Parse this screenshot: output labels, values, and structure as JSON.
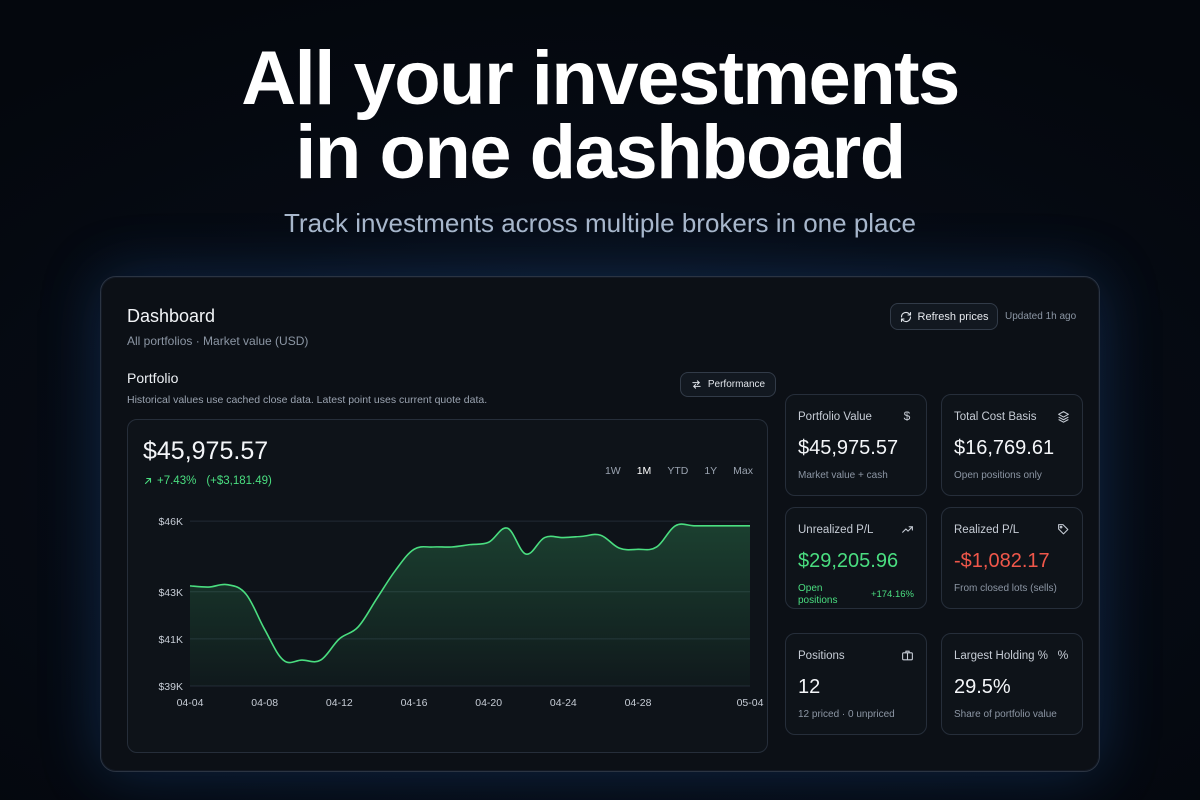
{
  "hero": {
    "title_line1": "All your investments",
    "title_line2": "in one dashboard",
    "subtitle": "Track investments across multiple brokers in one place"
  },
  "dashboard": {
    "title": "Dashboard",
    "subtitle": "All portfolios · Market value (USD)",
    "refresh_label": "Refresh prices",
    "updated": "Updated 1h ago"
  },
  "portfolio": {
    "title": "Portfolio",
    "note": "Historical values use cached close data. Latest point uses current quote data.",
    "performance_label": "Performance",
    "value": "$45,975.57",
    "change_pct": "+7.43%",
    "change_abs": "(+$3,181.49)",
    "ranges": [
      "1W",
      "1M",
      "YTD",
      "1Y",
      "Max"
    ],
    "active_range": "1M"
  },
  "chart_data": {
    "type": "area",
    "x": [
      "04-04",
      "04-05",
      "04-06",
      "04-07",
      "04-08",
      "04-09",
      "04-10",
      "04-11",
      "04-12",
      "04-13",
      "04-14",
      "04-15",
      "04-16",
      "04-17",
      "04-18",
      "04-19",
      "04-20",
      "04-21",
      "04-22",
      "04-23",
      "04-24",
      "04-25",
      "04-26",
      "04-27",
      "04-28",
      "04-29",
      "04-30",
      "05-01",
      "05-02",
      "05-03",
      "05-04"
    ],
    "values": [
      43250,
      43200,
      43300,
      42900,
      41400,
      40100,
      40100,
      40100,
      41000,
      41500,
      42700,
      43900,
      44800,
      44900,
      44900,
      45000,
      45100,
      45700,
      44600,
      45300,
      45300,
      45350,
      45400,
      44850,
      44800,
      44900,
      45800,
      45800,
      45800,
      45800,
      45800
    ],
    "x_tick_labels": [
      "04-04",
      "04-08",
      "04-12",
      "04-16",
      "04-20",
      "04-24",
      "04-28",
      "05-04"
    ],
    "y_tick_labels": [
      "$46K",
      "$43K",
      "$41K",
      "$39K"
    ],
    "y_ticks": [
      46000,
      43000,
      41000,
      39000
    ],
    "ylim": [
      39000,
      46300
    ],
    "grid": true,
    "line_color": "#4ade80"
  },
  "stats": [
    {
      "label": "Portfolio Value",
      "icon": "dollar-icon",
      "glyph": "$",
      "value": "$45,975.57",
      "foot": "Market value + cash",
      "tone": "neutral"
    },
    {
      "label": "Total Cost Basis",
      "icon": "layers-icon",
      "glyph": "",
      "value": "$16,769.61",
      "foot": "Open positions only",
      "tone": "neutral"
    },
    {
      "label": "Unrealized P/L",
      "icon": "trending-up-icon",
      "glyph": "",
      "value": "$29,205.96",
      "foot": "Open positions",
      "pct": "+174.16%",
      "tone": "pos"
    },
    {
      "label": "Realized P/L",
      "icon": "tag-icon",
      "glyph": "",
      "value": "-$1,082.17",
      "foot": "From closed lots (sells)",
      "tone": "neg"
    },
    {
      "label": "Positions",
      "icon": "briefcase-icon",
      "glyph": "",
      "value": "12",
      "foot": "12 priced · 0 unpriced",
      "tone": "neutral"
    },
    {
      "label": "Largest Holding %",
      "icon": "percent-icon",
      "glyph": "%",
      "value": "29.5%",
      "foot": "Share of portfolio value",
      "tone": "neutral"
    }
  ],
  "colors": {
    "positive": "#4ade80",
    "negative": "#f0574a",
    "panel_bg": "#0c1016"
  }
}
